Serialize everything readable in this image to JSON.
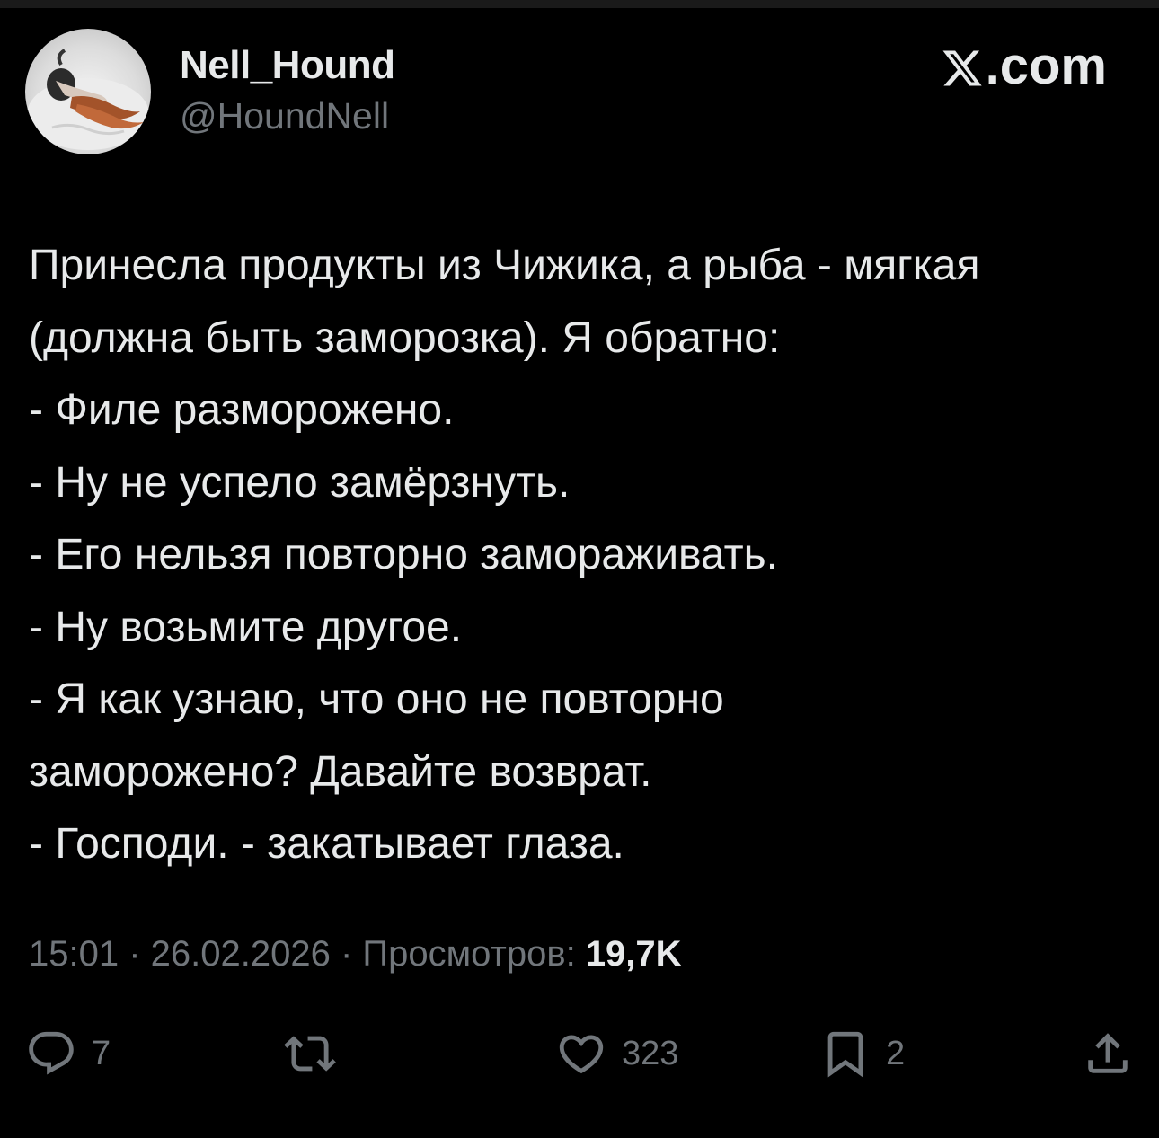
{
  "author": {
    "display_name": "Nell_Hound",
    "handle": "@HoundNell"
  },
  "brand": {
    "logo_icon": "x-logo-icon",
    "suffix": ".com"
  },
  "tweet": {
    "lines": [
      "Принесла продукты из Чижика, а рыба - мягкая",
      "(должна быть заморозка). Я обратно:",
      "- Филе разморожено.",
      "- Ну не успело замёрзнуть.",
      "- Его нельзя повторно замораживать.",
      "- Ну возьмите другое.",
      "- Я как узнаю, что оно не повторно",
      "заморожено? Давайте возврат.",
      "- Господи. - закатывает глаза."
    ]
  },
  "meta": {
    "time": "15:01",
    "separator": " · ",
    "date": "26.02.2026",
    "views_label": "Просмотров: ",
    "views_count": "19,7K"
  },
  "actions": {
    "reply": {
      "icon": "reply-icon",
      "count": "7"
    },
    "repost": {
      "icon": "repost-icon",
      "count": ""
    },
    "like": {
      "icon": "heart-icon",
      "count": "323"
    },
    "bookmark": {
      "icon": "bookmark-icon",
      "count": "2"
    },
    "share": {
      "icon": "share-icon"
    }
  },
  "colors": {
    "background": "#000000",
    "primary_text": "#e7e9ea",
    "secondary_text": "#71767b"
  }
}
